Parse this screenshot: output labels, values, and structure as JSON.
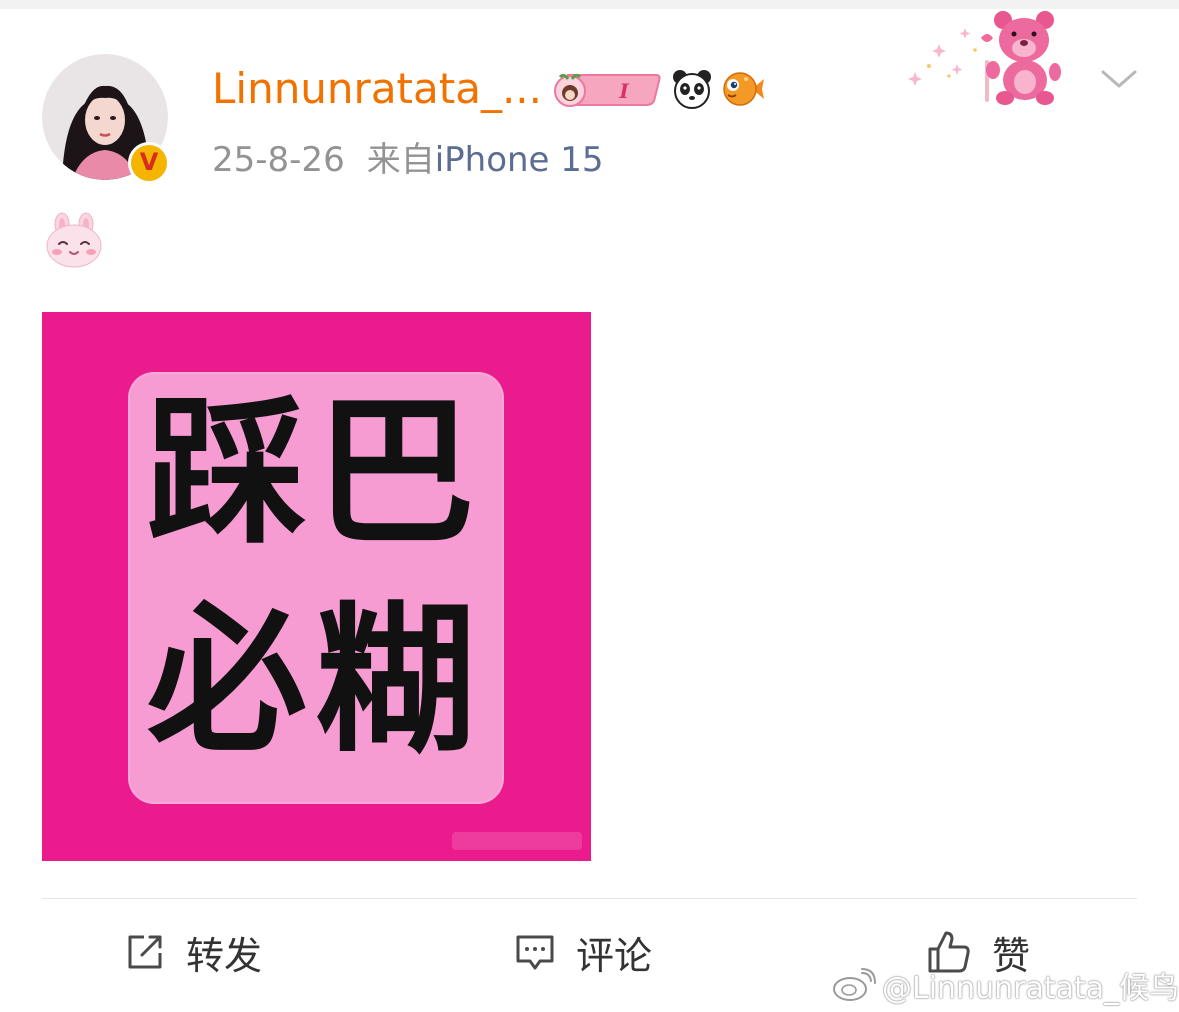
{
  "post": {
    "username": "Linnunratata_...",
    "date": "25-8-26",
    "source_prefix": "来自",
    "source_device": "iPhone 15",
    "verified_mark": "V",
    "fan_badge_text": "I",
    "text_emoji": "bunny-smile-emoji",
    "image_text": {
      "char1": "踩",
      "char2": "巴",
      "char3": "必",
      "char4": "糊"
    }
  },
  "actions": {
    "repost_label": "转发",
    "comment_label": "评论",
    "like_label": "赞"
  },
  "watermark": {
    "text": "@Linnunratata_候鸟"
  },
  "icons": {
    "verified": "verified-badge-icon",
    "panda": "panda-icon",
    "fish": "fish-icon",
    "repost": "repost-icon",
    "comment": "comment-icon",
    "like": "thumbs-up-icon",
    "more": "chevron-down-icon",
    "weibo": "weibo-logo-icon"
  },
  "colors": {
    "username": "#f27200",
    "source_link": "#5b6d92",
    "meta": "#939393",
    "image_bg": "#ea1b8c",
    "image_card": "#f79bd3",
    "verified_badge": "#f4b400"
  }
}
